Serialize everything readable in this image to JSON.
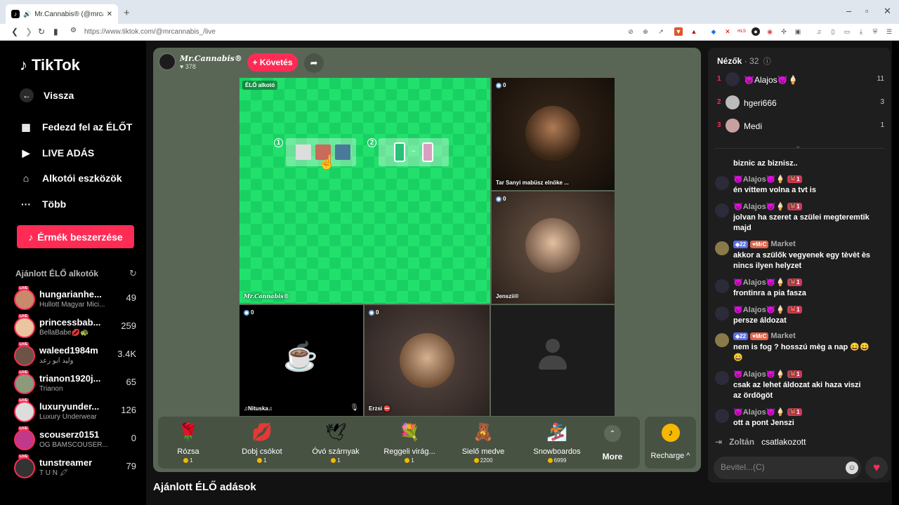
{
  "browser": {
    "tab_title": "Mr.Cannabis® (@mrcanna...",
    "new_tab": "+",
    "url": "https://www.tiktok.com/@mrcannabis_/live",
    "win_min": "–",
    "win_max": "▫",
    "win_close": "✕"
  },
  "sidebar": {
    "logo": "TikTok",
    "nav": [
      {
        "label": "Vissza"
      },
      {
        "label": "Fedezd fel az ÉLŐT"
      },
      {
        "label": "LIVE ADÁS"
      },
      {
        "label": "Alkotói eszközök"
      },
      {
        "label": "Több"
      }
    ],
    "coins_button": "Érmék beszerzése",
    "recommended_title": "Ajánlott ÉLŐ alkotók",
    "creators": [
      {
        "name": "hungarianhe...",
        "sub": "Hullott Magyar Mici...",
        "count": "49"
      },
      {
        "name": "princessbab...",
        "sub": "BellaBabe💋🐢",
        "count": "259"
      },
      {
        "name": "waleed1984m",
        "sub": "وليد ابو رعد",
        "count": "3.4K"
      },
      {
        "name": "trianon1920j...",
        "sub": "Trianon",
        "count": "65"
      },
      {
        "name": "luxuryunder...",
        "sub": "Luxury Underwear",
        "count": "126"
      },
      {
        "name": "scouserz0151",
        "sub": "OG BAMSCOUSER...",
        "count": "0"
      },
      {
        "name": "tunstreamer",
        "sub": "T U N 🖍",
        "count": "79"
      }
    ],
    "live_badge": "LIVE"
  },
  "stage": {
    "host_name": "Mr.Cannabis®",
    "host_likes": "♥ 378",
    "follow_button": "+ Követés",
    "green_label": "ÉLŐ alkotó",
    "green_footer": "Mr.Cannabis®",
    "step1": "①",
    "step2": "②",
    "guests": [
      {
        "label": "Tar Sanyi mabüsz elnöke ...",
        "count": "0"
      },
      {
        "label": "Jenszii®",
        "count": "0"
      },
      {
        "label": "♫Nituska♫",
        "count": "0"
      },
      {
        "label": "Erzsi ⛔",
        "count": "0"
      }
    ]
  },
  "gifts": [
    {
      "name": "Rózsa",
      "price": "1",
      "icon": "🌹"
    },
    {
      "name": "Dobj csókot",
      "price": "1",
      "icon": "💋"
    },
    {
      "name": "Óvó szárnyak",
      "price": "1",
      "icon": "🕊"
    },
    {
      "name": "Reggeli virág...",
      "price": "1",
      "icon": "💐"
    },
    {
      "name": "Sielő medve",
      "price": "2200",
      "icon": "🧸"
    },
    {
      "name": "Snowboardos",
      "price": "6999",
      "icon": "🏂"
    }
  ],
  "gift_more": "More",
  "recharge": "Recharge ^",
  "below_title": "Ajánlott ÉLŐ adások",
  "viewers": {
    "title": "Nézők",
    "count": "· 32",
    "list": [
      {
        "rank": "1",
        "name": "😈Alajos😈🍦",
        "score": "11"
      },
      {
        "rank": "2",
        "name": "hgeri666",
        "score": "3"
      },
      {
        "rank": "3",
        "name": "Medi",
        "score": "1"
      }
    ]
  },
  "chat": [
    {
      "user": "",
      "text": "biznic az biznisz..",
      "badges": []
    },
    {
      "user": "😈Alajos😈🍦",
      "text": "én vittem volna a tvt is",
      "badges": [
        "👹1"
      ]
    },
    {
      "user": "😈Alajos😈🍦",
      "text": "jolvan ha szeret a szülei megteremtik majd",
      "badges": [
        "👹1"
      ]
    },
    {
      "user": "Market",
      "text": "akkor a szülők vegyenek egy tèvèt ès nincs ilyen helyzet",
      "badges": [
        "◆22",
        "♥MrC"
      ]
    },
    {
      "user": "😈Alajos😈🍦",
      "text": "frontinra a pia fasza",
      "badges": [
        "👹1"
      ]
    },
    {
      "user": "😈Alajos😈🍦",
      "text": "persze áldozat",
      "badges": [
        "👹1"
      ]
    },
    {
      "user": "Market",
      "text": "nem is fog ? hosszú mèg a nap 😄😄😄",
      "badges": [
        "◆22",
        "♥MrC"
      ]
    },
    {
      "user": "😈Alajos😈🍦",
      "text": "csak az lehet áldozat aki haza viszi az ördögöt",
      "badges": [
        "👹1"
      ]
    },
    {
      "user": "😈Alajos😈🍦",
      "text": "ott a pont Jenszi",
      "badges": [
        "👹1"
      ]
    }
  ],
  "join": {
    "user": "Zoltán",
    "text": "csatlakozott"
  },
  "input": {
    "placeholder": "Bevitel...(C)"
  },
  "colors": {
    "accent": "#fe2c55",
    "stage_bg": "#5a6655",
    "green_screen": "#19d162"
  }
}
